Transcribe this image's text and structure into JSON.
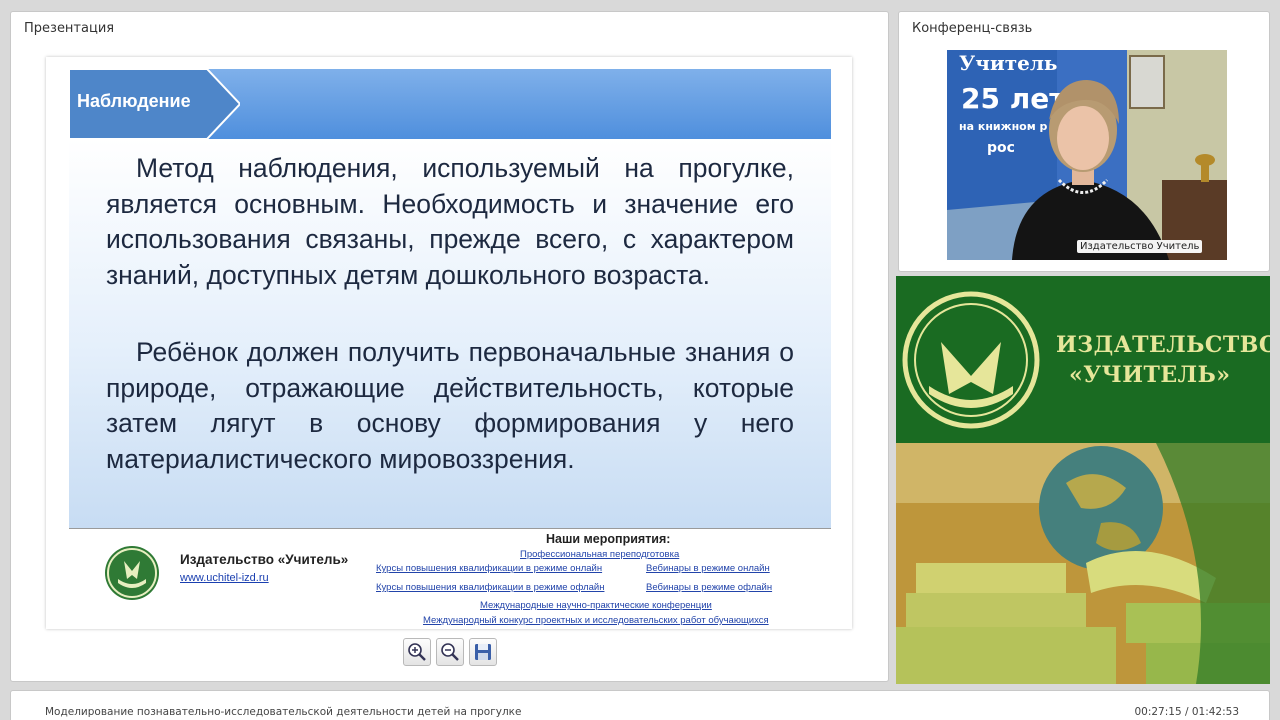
{
  "panels": {
    "presentation_title": "Презентация",
    "conference_title": "Конференц-связь"
  },
  "slide": {
    "header": "Наблюдение",
    "paragraphs": [
      "Метод наблюдения, используемый на прогулке, является основным. Необходимость и значение его использования связаны, прежде всего, с характером знаний, доступных детям дошкольного возраста.",
      "Ребёнок должен получить первоначальные знания о природе, отражающие действительность, которые затем лягут в основу формирования у него материалистического мировоззрения."
    ],
    "footer": {
      "brand": "Издательство «Учитель»",
      "url": "www.uchitel-izd.ru",
      "events_title": "Наши мероприятия:",
      "events": [
        "Профессиональная переподготовка",
        "Курсы повышения квалификации в режиме онлайн",
        "Вебинары в режиме онлайн",
        "Курсы повышения квалификации в режиме офлайн",
        "Вебинары в режиме офлайн",
        "Международные научно-практические конференции",
        "Международный конкурс проектных и исследовательских работ обучающихся"
      ]
    }
  },
  "toolbar": {
    "icons": [
      "zoom-in-icon",
      "zoom-out-icon",
      "save-icon"
    ]
  },
  "video": {
    "speaker_label": "Издательство Учитель",
    "backdrop_text": [
      "Учитель",
      "25 лет",
      "на книжном р",
      "рос"
    ]
  },
  "promo": {
    "line1": "ИЗДАТЕЛЬСТВО",
    "line2": "«УЧИТЕЛЬ»",
    "colors": {
      "green": "#1a6b22",
      "text": "#e6e69a"
    }
  },
  "status": {
    "title": "Моделирование познавательно-исследовательской деятельности детей на прогулке",
    "time": "00:27:15 / 01:42:53"
  }
}
